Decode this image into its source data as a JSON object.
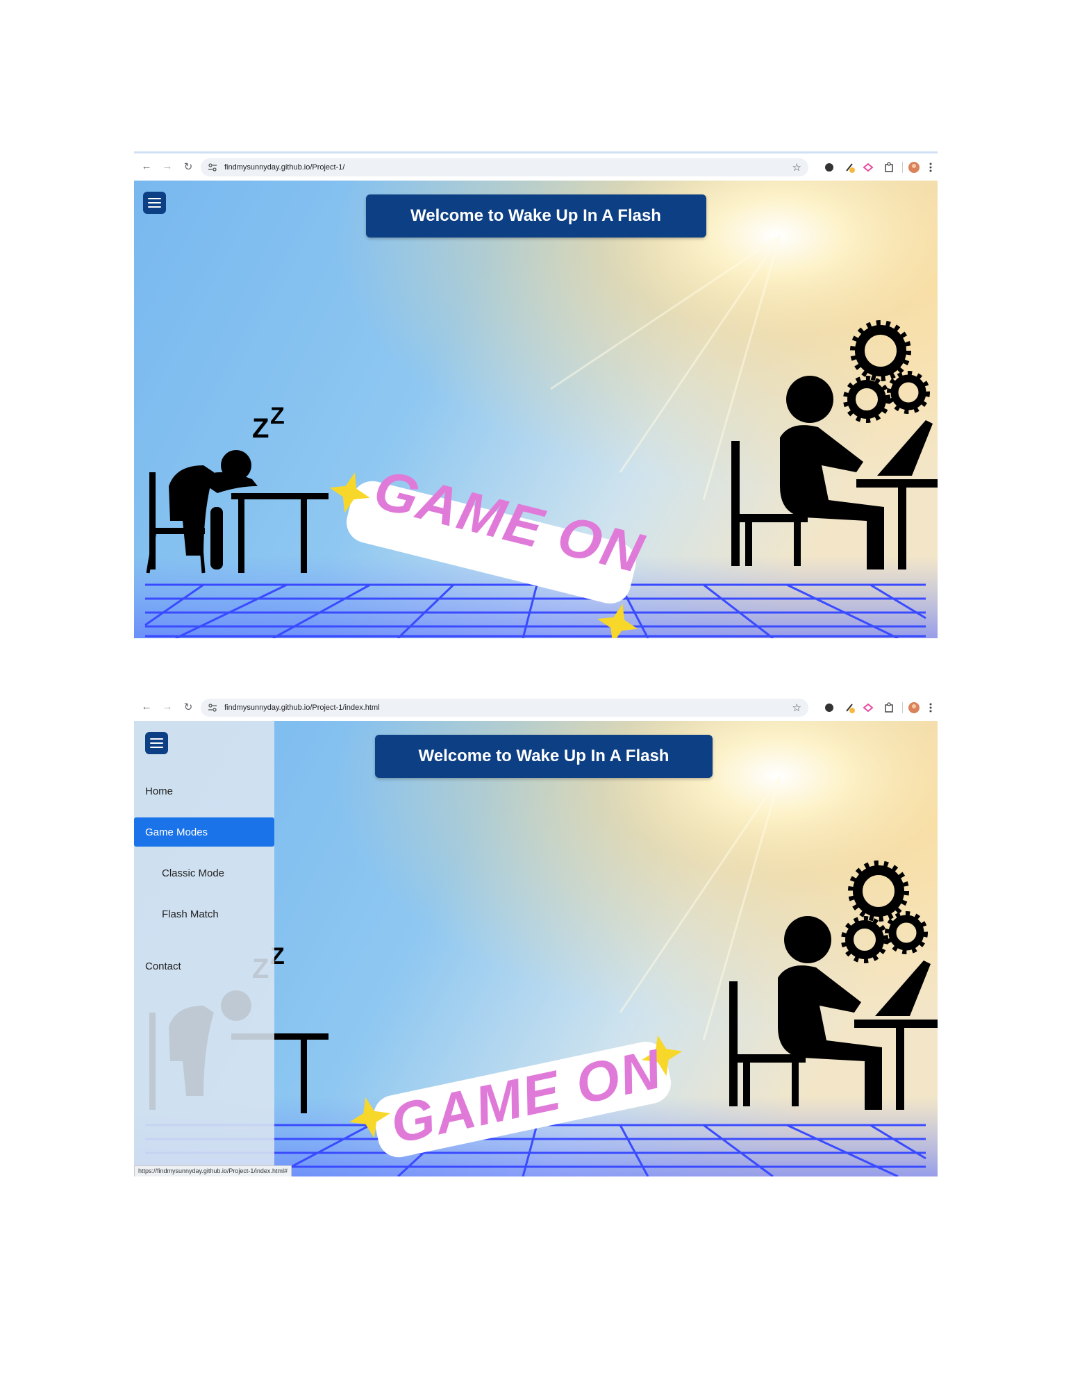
{
  "screenshots": [
    {
      "url": "findmysunnyday.github.io/Project-1/",
      "banner": "Welcome to Wake Up In A Flash",
      "sticker": "GAME ON",
      "zzz": "ZZ"
    },
    {
      "url": "findmysunnyday.github.io/Project-1/index.html",
      "banner": "Welcome to Wake Up In A Flash",
      "sticker": "GAME ON",
      "zzz": "ZZ",
      "sidebar": {
        "items": [
          {
            "label": "Home"
          },
          {
            "label": "Game Modes"
          },
          {
            "label": "Classic Mode"
          },
          {
            "label": "Flash Match"
          },
          {
            "label": "Contact"
          }
        ]
      },
      "status_url": "https://findmysunnyday.github.io/Project-1/index.html#"
    }
  ],
  "icons": {
    "back": "arrow-left",
    "forward": "arrow-right",
    "reload": "reload",
    "site_info": "tune",
    "bookmark": "star",
    "menu": "hamburger",
    "more": "vertical-dots"
  },
  "colors": {
    "banner_bg": "#0d3f84",
    "menu_button_bg": "#0d3f84",
    "active_item_bg": "#1a73e8",
    "sticker_text": "#e07ad9",
    "sparkle": "#f7d82a",
    "floor_grid": "#3a4bff"
  }
}
